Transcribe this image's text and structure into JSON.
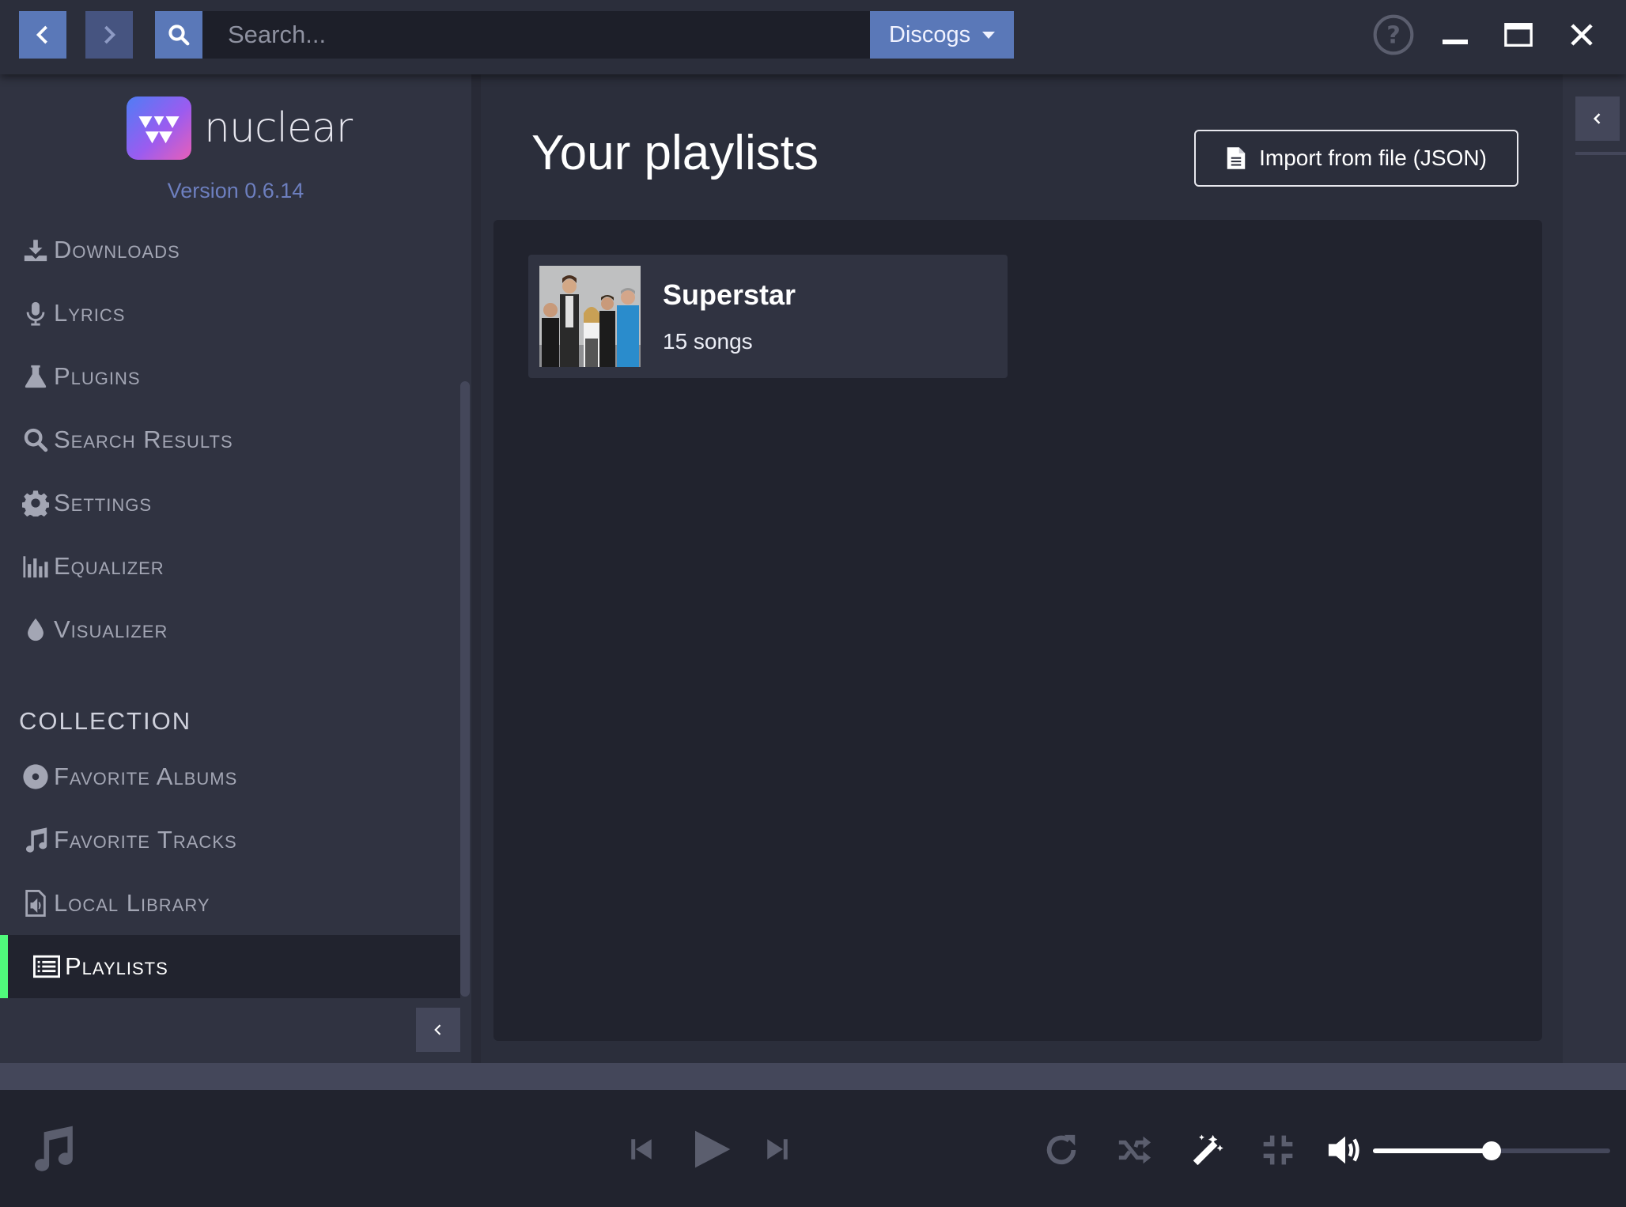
{
  "topbar": {
    "search_placeholder": "Search...",
    "provider": "Discogs"
  },
  "sidebar": {
    "app_name": "nuclear",
    "version": "Version 0.6.14",
    "items": [
      {
        "label": "Downloads",
        "icon": "download-icon"
      },
      {
        "label": "Lyrics",
        "icon": "microphone-icon"
      },
      {
        "label": "Plugins",
        "icon": "flask-icon"
      },
      {
        "label": "Search Results",
        "icon": "search-icon"
      },
      {
        "label": "Settings",
        "icon": "gear-icon"
      },
      {
        "label": "Equalizer",
        "icon": "equalizer-icon"
      },
      {
        "label": "Visualizer",
        "icon": "drop-icon"
      }
    ],
    "collection_header": "COLLECTION",
    "collection": [
      {
        "label": "Favorite Albums",
        "icon": "disc-icon"
      },
      {
        "label": "Favorite Tracks",
        "icon": "music-note-icon"
      },
      {
        "label": "Local Library",
        "icon": "audio-file-icon"
      },
      {
        "label": "Playlists",
        "icon": "list-icon",
        "active": true
      }
    ]
  },
  "main": {
    "title": "Your playlists",
    "import_label": "Import from file (JSON)",
    "playlists": [
      {
        "name": "Superstar",
        "count": "15 songs"
      }
    ]
  },
  "player": {
    "volume": 0.5
  },
  "colors": {
    "accent": "#5a78b8",
    "active_indicator": "#50fa7b",
    "sidebar_bg": "#303341",
    "panel_bg": "#21232e"
  }
}
